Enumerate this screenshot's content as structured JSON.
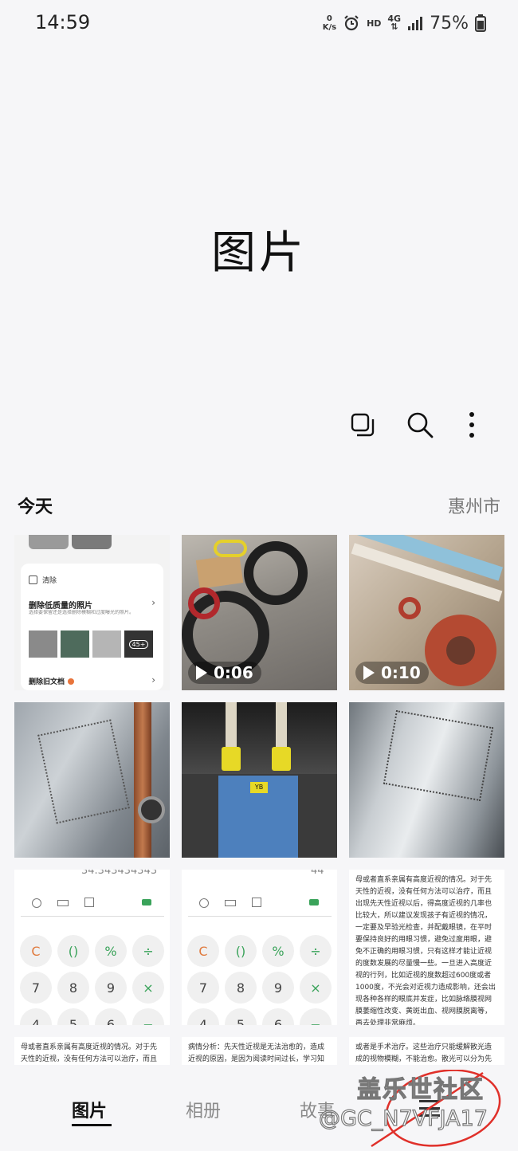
{
  "status_bar": {
    "time": "14:59",
    "speed_value": "0",
    "speed_unit": "K/s",
    "hd": "HD",
    "network": "4G",
    "battery": "75%"
  },
  "header": {
    "title": "图片"
  },
  "toolbar": {
    "icons": [
      "select-icon",
      "search-icon",
      "more-icon"
    ]
  },
  "section": {
    "label": "今天",
    "location": "惠州市"
  },
  "thumbnails": {
    "t1": {
      "heading": "清除",
      "item1": "删除低质量的照片",
      "item1_desc": "选择要保留还是选择删除模糊和过度曝光的照片。",
      "badge": "45+",
      "item2": "删除旧文档"
    },
    "t2": {
      "duration": "0:06"
    },
    "t3": {
      "duration": "0:10"
    },
    "t5": {
      "label": "YB"
    },
    "t7": {
      "top": "34.343434343",
      "keys": [
        "C",
        "()",
        "%",
        "÷",
        "7",
        "8",
        "9",
        "×",
        "4",
        "5",
        "6",
        "−"
      ]
    },
    "t8": {
      "top": "44",
      "keys": [
        "C",
        "()",
        "%",
        "÷",
        "7",
        "8",
        "9",
        "×",
        "4",
        "5",
        "6",
        "−"
      ]
    },
    "t9": {
      "text": "母或者直系亲属有高度近视的情况。对于先天性的近视，没有任何方法可以治疗，而且出现先天性近视以后，得高度近视的几率也比较大，所以建议发现孩子有近视的情况，一定要及早验光检查，并配戴眼镜，在平时要保持良好的用眼习惯，避免过度用眼，避免不正确的用眼习惯，只有这样才能让近视的度数发展的尽量慢一些。一旦进入高度近视的行列，比如近视的度数超过600度或者1000度，不光会对近视力造成影响，还会出现各种各样的眼底并发症，比如脉络膜视网膜萎缩性改变、黄斑出血、视网膜脱离等，再去处理非常麻烦。"
    },
    "t10": {
      "text": "母或者直系亲属有高度近视的情况。对于先天性的近视，没有任何方法可以治疗，而且出现先天性近视以后，得高度近视的几率也比较大"
    },
    "t11": {
      "text": "病情分析：先天性近视是无法治愈的，造成近视的原因，是因为阅读时间过长，学习知识不"
    },
    "t12": {
      "text": "或者是手术治疗。这些治疗只能缓解散光造成的视物模糊，不能治愈。散光可以分为先天性"
    }
  },
  "bottom_nav": {
    "tabs": [
      "图片",
      "相册",
      "故事"
    ],
    "active": "图片",
    "menu_icon": "menu-icon"
  },
  "watermark": {
    "line1": "盖乐世社区",
    "line2": "@GC_N7VFJA17"
  },
  "colors": {
    "accent_teal": "#3fb5a8",
    "calc_orange": "#e07a3d",
    "calc_green": "#3aa35a"
  }
}
